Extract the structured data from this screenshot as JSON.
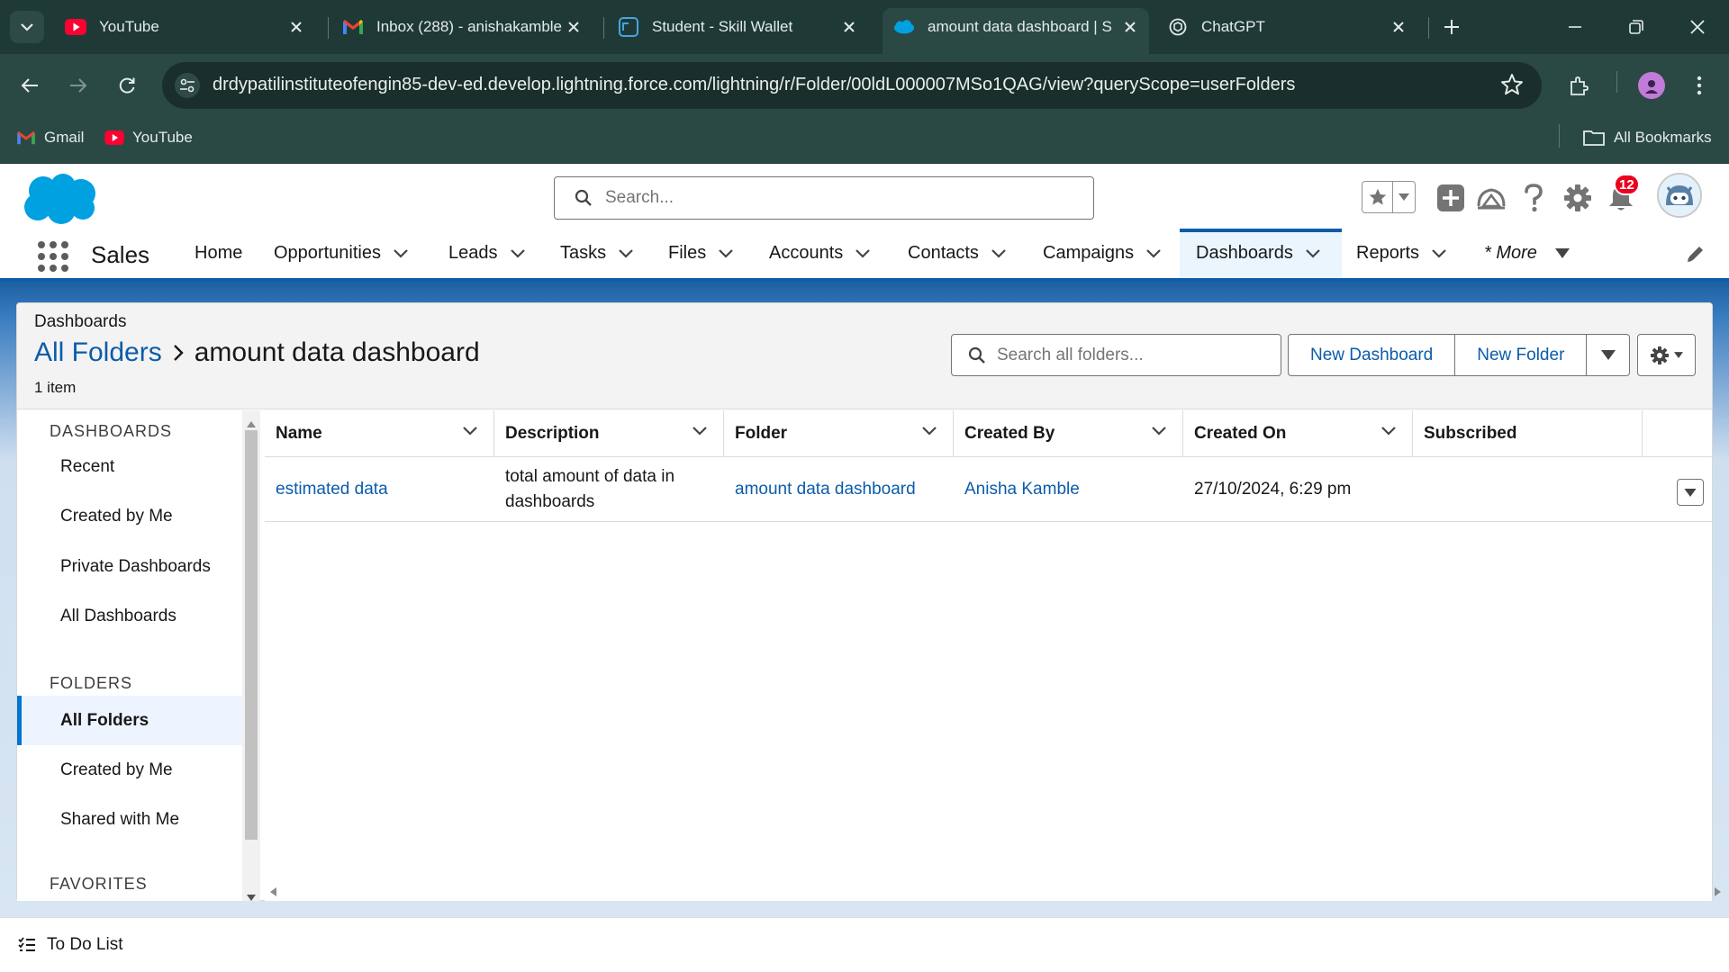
{
  "browser": {
    "tabs": [
      {
        "title": "YouTube",
        "icon": "youtube-icon"
      },
      {
        "title": "Inbox (288) - anishakamble",
        "icon": "gmail-icon"
      },
      {
        "title": "Student - Skill Wallet",
        "icon": "skill-wallet-icon"
      },
      {
        "title": "amount data dashboard | S",
        "icon": "salesforce-cloud-icon",
        "active": true
      },
      {
        "title": "ChatGPT",
        "icon": "chatgpt-icon"
      }
    ],
    "url": "drdypatilinstituteofengin85-dev-ed.develop.lightning.force.com/lightning/r/Folder/00ldL000007MSo1QAG/view?queryScope=userFolders",
    "bookmarks": [
      {
        "label": "Gmail",
        "icon": "gmail-icon"
      },
      {
        "label": "YouTube",
        "icon": "youtube-icon"
      }
    ],
    "all_bookmarks_label": "All Bookmarks"
  },
  "salesforce": {
    "search_placeholder": "Search...",
    "notification_count": "12",
    "app_name": "Sales",
    "nav_items": [
      {
        "label": "Home",
        "has_menu": false
      },
      {
        "label": "Opportunities",
        "has_menu": true
      },
      {
        "label": "Leads",
        "has_menu": true
      },
      {
        "label": "Tasks",
        "has_menu": true
      },
      {
        "label": "Files",
        "has_menu": true
      },
      {
        "label": "Accounts",
        "has_menu": true
      },
      {
        "label": "Contacts",
        "has_menu": true
      },
      {
        "label": "Campaigns",
        "has_menu": true
      },
      {
        "label": "Dashboards",
        "has_menu": true,
        "active": true
      },
      {
        "label": "Reports",
        "has_menu": true
      }
    ],
    "nav_more_label": "* More",
    "colors": {
      "brand": "#0b5cab",
      "accent": "#0176d3",
      "badge": "#ea001e"
    }
  },
  "page_header": {
    "eyebrow": "Dashboards",
    "breadcrumb_link": "All Folders",
    "title": "amount data dashboard",
    "item_count": "1 item",
    "folder_search_placeholder": "Search all folders...",
    "new_dashboard_label": "New Dashboard",
    "new_folder_label": "New Folder"
  },
  "sidebar": {
    "sections": [
      {
        "title": "DASHBOARDS",
        "items": [
          "Recent",
          "Created by Me",
          "Private Dashboards",
          "All Dashboards"
        ]
      },
      {
        "title": "FOLDERS",
        "items": [
          "All Folders",
          "Created by Me",
          "Shared with Me"
        ]
      },
      {
        "title": "FAVORITES",
        "items": []
      }
    ],
    "selected": "All Folders"
  },
  "table": {
    "columns": [
      "Name",
      "Description",
      "Folder",
      "Created By",
      "Created On",
      "Subscribed"
    ],
    "rows": [
      {
        "name": "estimated data",
        "description": "total amount of data in dashboards",
        "folder": "amount data dashboard",
        "created_by": "Anisha Kamble",
        "created_on": "27/10/2024, 6:29 pm",
        "subscribed": ""
      }
    ]
  },
  "utility_bar": {
    "todo_label": "To Do List"
  }
}
